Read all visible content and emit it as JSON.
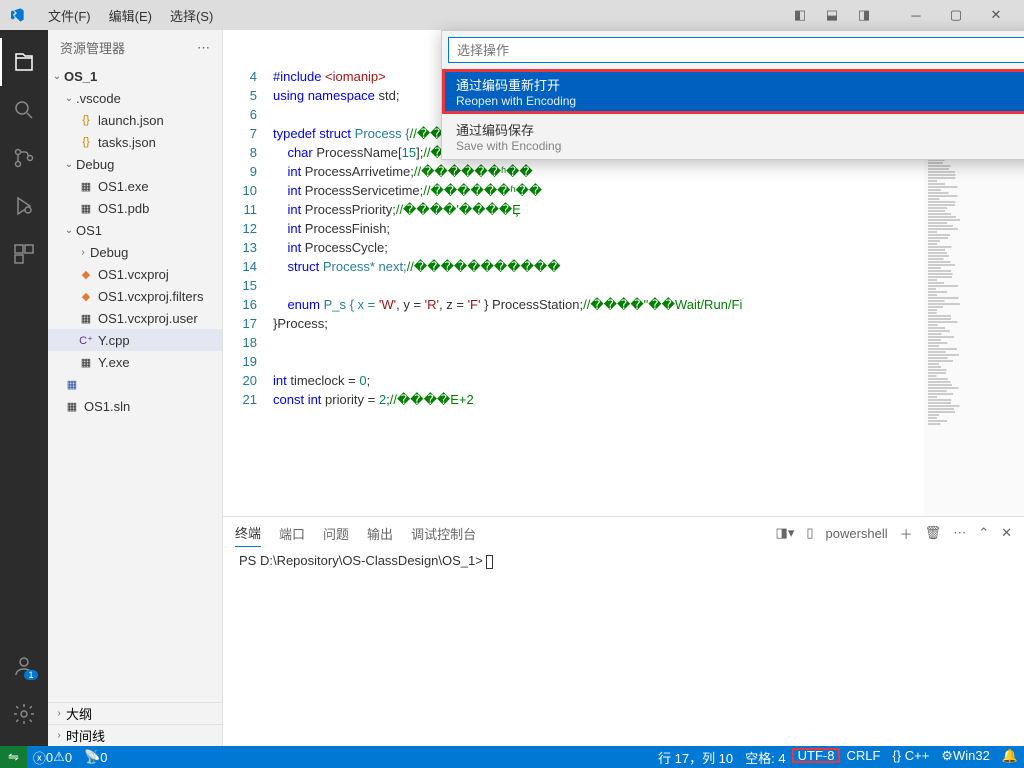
{
  "menubar": {
    "file": "文件(F)",
    "edit": "编辑(E)",
    "select": "选择(S)"
  },
  "sidebar": {
    "title": "资源管理器",
    "root": "OS_1",
    "folders": {
      "vscode": ".vscode",
      "debug": "Debug",
      "os1": "OS1",
      "debug2": "Debug"
    },
    "files": {
      "launch": "launch.json",
      "tasks": "tasks.json",
      "os1exe": "OS1.exe",
      "os1pdb": "OS1.pdb",
      "vcxproj": "OS1.vcxproj",
      "filters": "OS1.vcxproj.filters",
      "user": "OS1.vcxproj.user",
      "ycpp": "Y.cpp",
      "yexe": "Y.exe",
      "blank": " ",
      "sln": "OS1.sln"
    },
    "sections": {
      "outline": "大纲",
      "timeline": "时间线"
    }
  },
  "palette": {
    "placeholder": "选择操作",
    "items": [
      {
        "title": "通过编码重新打开",
        "sub": "Reopen with Encoding"
      },
      {
        "title": "通过编码保存",
        "sub": "Save with Encoding"
      }
    ]
  },
  "code": {
    "lines": [
      4,
      5,
      6,
      7,
      8,
      9,
      10,
      11,
      12,
      13,
      14,
      15,
      16,
      17,
      18,
      19,
      20,
      21
    ],
    "l4": {
      "a": "#include ",
      "b": "<iomanip>"
    },
    "l5": {
      "a": "using ",
      "b": "namespace ",
      "c": "std;"
    },
    "l7": {
      "a": "typedef ",
      "b": "struct ",
      "c": "Process {",
      "d": "//�����p�Process"
    },
    "l8": {
      "a": "    ",
      "b": "char ",
      "c": "ProcessName[",
      "d": "15",
      "e": "];",
      "f": "//������"
    },
    "l9": {
      "a": "    ",
      "b": "int ",
      "c": "ProcessArrivetime;",
      "d": "//������ʱ��"
    },
    "l10": {
      "a": "    ",
      "b": "int ",
      "c": "ProcessServicetime;",
      "d": "//������ʱ��"
    },
    "l11": {
      "a": "    ",
      "b": "int ",
      "c": "ProcessPriority;",
      "d": "//����'����Ȩ"
    },
    "l12": {
      "a": "    ",
      "b": "int ",
      "c": "ProcessFinish;"
    },
    "l13": {
      "a": "    ",
      "b": "int ",
      "c": "ProcessCycle;"
    },
    "l14": {
      "a": "    ",
      "b": "struct ",
      "c": "Process* next;",
      "d": "//�����������"
    },
    "l16": {
      "a": "    ",
      "b": "enum ",
      "c": "P_s { x = ",
      "d": "'W'",
      "e": ", y = ",
      "f": "'R'",
      "g": ", z = ",
      "h": "'F'",
      "i": " } ProcessStation;",
      "j": "//����\"��Wait/Run/Fi"
    },
    "l17": "}Process;",
    "l20": {
      "a": "int ",
      "b": "timeclock = ",
      "c": "0",
      "d": ";"
    },
    "l21": {
      "a": "const ",
      "b": "int ",
      "c": "priority = ",
      "d": "2",
      "e": ";",
      "f": "//����E+2"
    }
  },
  "panel": {
    "tabs": {
      "terminal": "终端",
      "port": "端口",
      "problems": "问题",
      "output": "输出",
      "debug": "调试控制台"
    },
    "shell": "powershell",
    "prompt": "PS D:\\Repository\\OS-ClassDesign\\OS_1> "
  },
  "statusbar": {
    "errors": "0",
    "warnings": "0",
    "port": "0",
    "line": "行 17，列 10",
    "spaces": "空格: 4",
    "encoding": "UTF-8",
    "eol": "CRLF",
    "lang": "{} C++",
    "platform": "Win32"
  }
}
